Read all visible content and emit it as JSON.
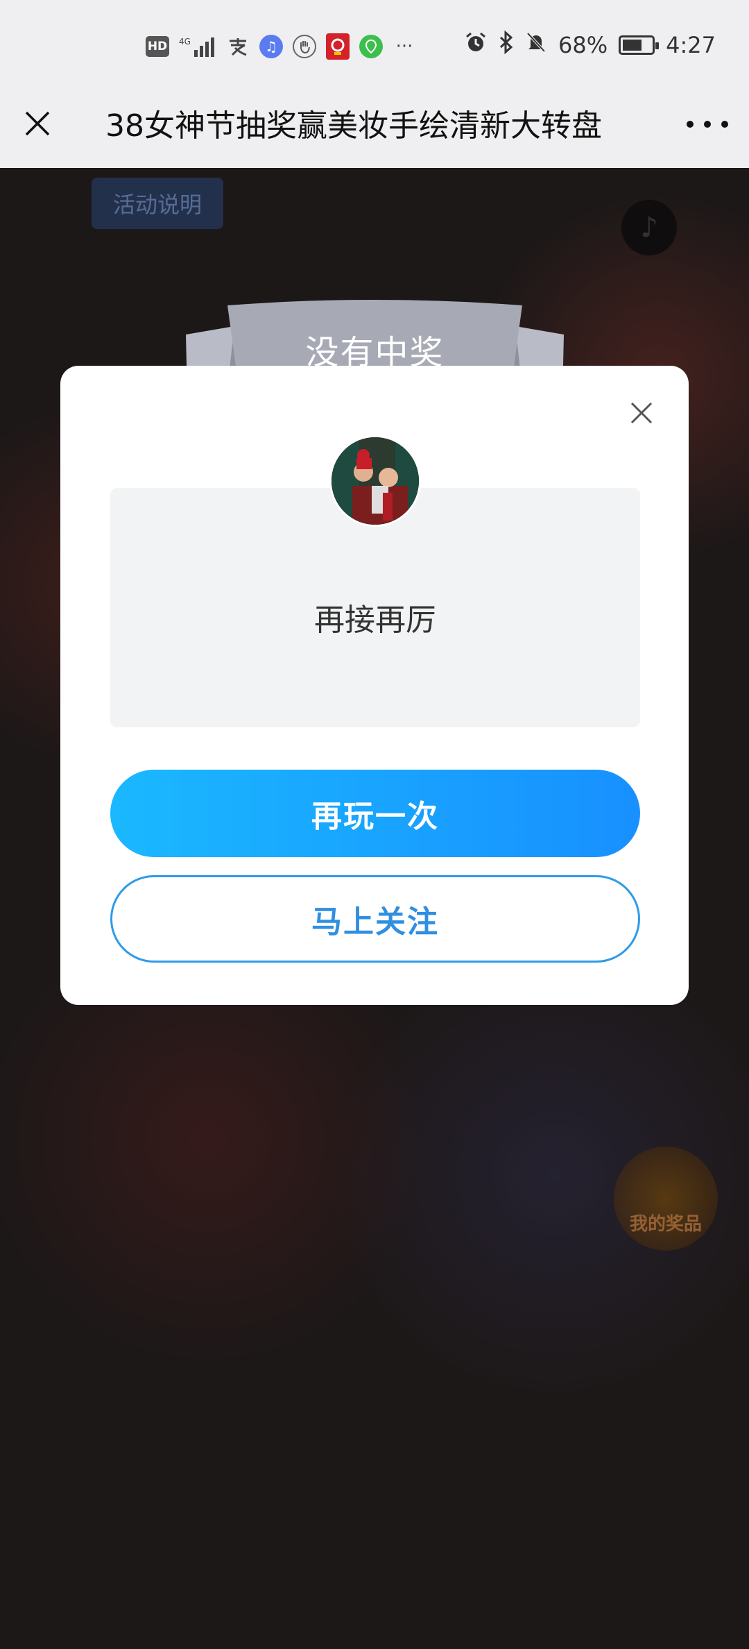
{
  "status_bar": {
    "left_icons": [
      "hd-icon",
      "signal-4g-icon",
      "payment-app-icon",
      "music-app-icon",
      "hand-app-icon",
      "badge-app-icon",
      "map-app-icon",
      "more-dots-icon"
    ],
    "hd_label": "HD",
    "network_label": "4G",
    "more_label": "···",
    "battery": "68%",
    "battery_level": 0.68,
    "time": "4:27"
  },
  "navbar": {
    "title": "38女神节抽奖赢美妆手绘清新大转盘"
  },
  "background": {
    "activity_button": "活动说明",
    "music_icon": "♪",
    "center_hint": "",
    "my_prize_label": "我的奖品"
  },
  "modal": {
    "banner_title": "没有中奖",
    "result_text": "再接再厉",
    "play_again_label": "再玩一次",
    "follow_label": "马上关注"
  },
  "colors": {
    "primary_start": "#1ab8ff",
    "primary_end": "#1890ff",
    "outline": "#2f9be8",
    "overlay": "#1d1818"
  }
}
